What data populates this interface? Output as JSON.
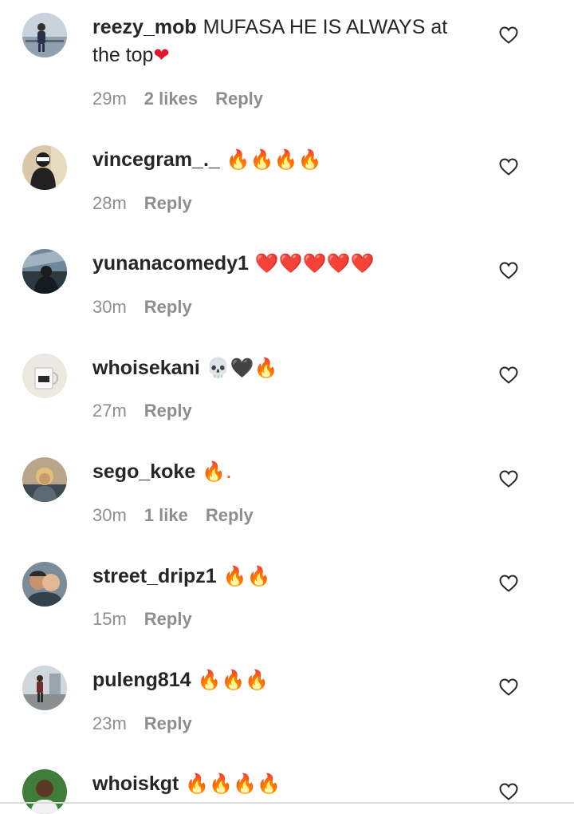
{
  "comments": [
    {
      "username": "reezy_mob",
      "text": "MUFASA HE IS ALWAYS at the top❤️",
      "time": "29m",
      "likes": "2 likes",
      "reply": "Reply",
      "avatar": "person-bridge-avatar"
    },
    {
      "username": "vincegram_._",
      "text": "🔥🔥🔥🔥",
      "time": "28m",
      "likes": "",
      "reply": "Reply",
      "avatar": "masked-person-avatar"
    },
    {
      "username": "yunanacomedy1",
      "text": "❤️❤️❤️❤️❤️",
      "time": "30m",
      "likes": "",
      "reply": "Reply",
      "avatar": "dark-outdoor-avatar"
    },
    {
      "username": "whoisekani",
      "text": "💀🖤🔥",
      "time": "27m",
      "likes": "",
      "reply": "Reply",
      "avatar": "mug-avatar"
    },
    {
      "username": "sego_koke",
      "text": "🔥.",
      "time": "30m",
      "likes": "1 like",
      "reply": "Reply",
      "avatar": "blonde-person-avatar"
    },
    {
      "username": "street_dripz1",
      "text": "🔥🔥",
      "time": "15m",
      "likes": "",
      "reply": "Reply",
      "avatar": "couple-avatar"
    },
    {
      "username": "puleng814",
      "text": "🔥🔥🔥",
      "time": "23m",
      "likes": "",
      "reply": "Reply",
      "avatar": "standing-person-avatar"
    },
    {
      "username": "whoiskgt",
      "text": "🔥🔥🔥🔥",
      "time": "",
      "likes": "",
      "reply": "",
      "avatar": "smiling-person-avatar"
    }
  ],
  "colors": {
    "text": "#262626",
    "meta": "#8e8e8e",
    "heart_outline": "#262626",
    "fire": "#f4511e",
    "red_heart": "#e0162b"
  }
}
